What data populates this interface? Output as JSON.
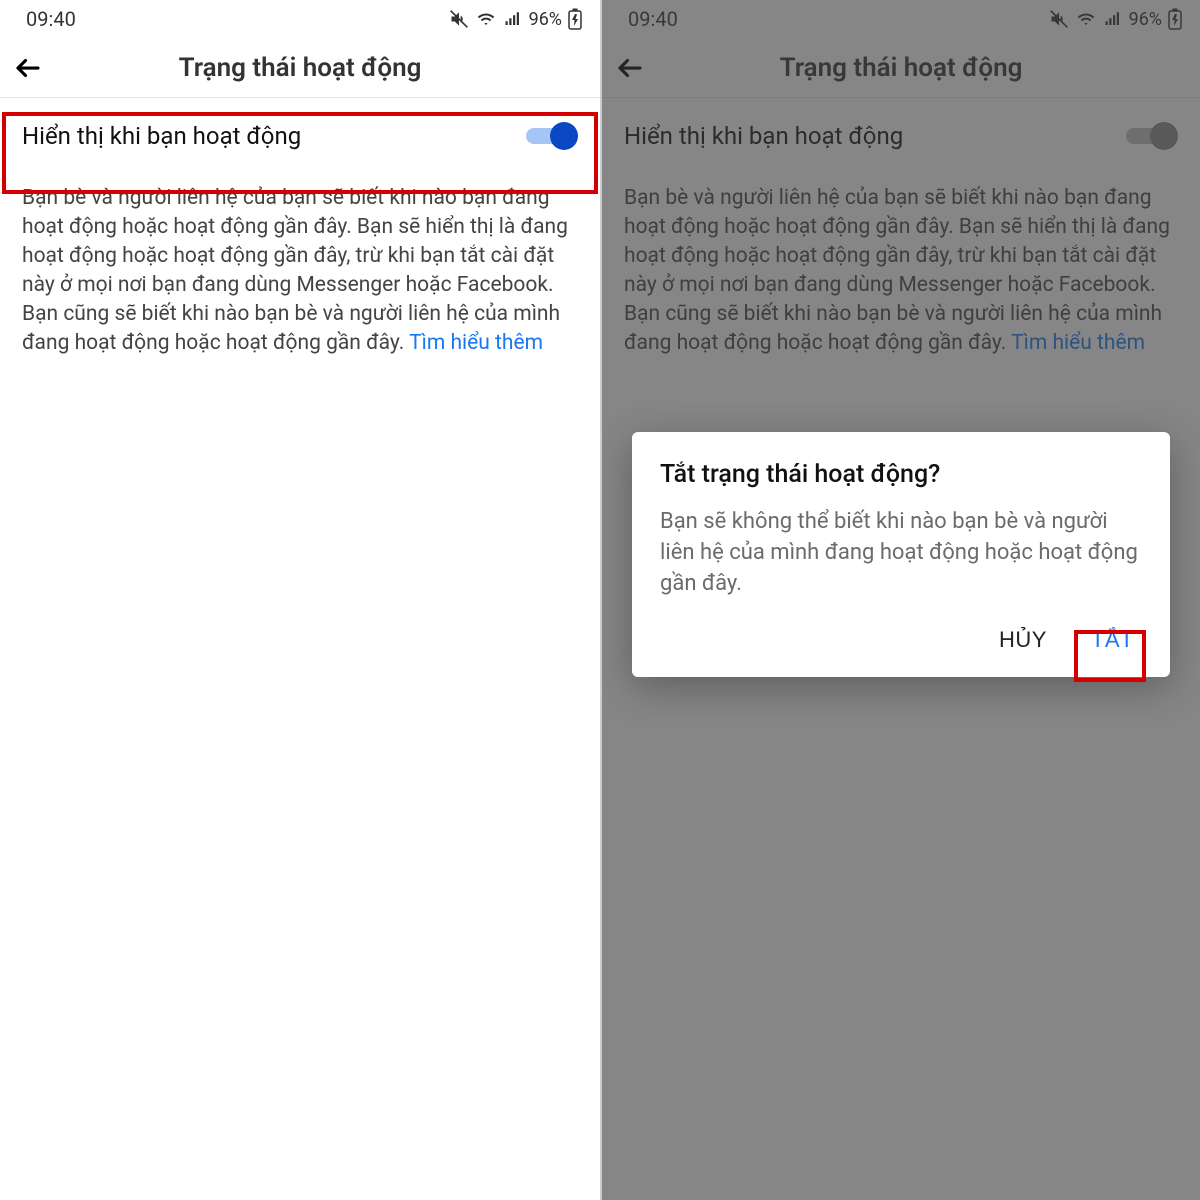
{
  "status": {
    "time": "09:40",
    "battery": "96%"
  },
  "header": {
    "title": "Trạng thái hoạt động"
  },
  "toggle": {
    "label": "Hiển thị khi bạn hoạt động"
  },
  "description": {
    "text": "Bạn bè và người liên hệ của bạn sẽ biết khi nào bạn đang hoạt động hoặc hoạt động gần đây. Bạn sẽ hiển thị là đang hoạt động hoặc hoạt động gần đây, trừ khi bạn tắt cài đặt này ở mọi nơi bạn đang dùng Messenger hoặc Facebook. Bạn cũng sẽ biết khi nào bạn bè và người liên hệ của mình đang hoạt động hoặc hoạt động gần đây. ",
    "link": "Tìm hiểu thêm"
  },
  "dialog": {
    "title": "Tắt trạng thái hoạt động?",
    "body": "Bạn sẽ không thể biết khi nào bạn bè và người liên hệ của mình đang hoạt động hoặc hoạt động gần đây.",
    "cancel": "HỦY",
    "confirm": "TẮT"
  }
}
